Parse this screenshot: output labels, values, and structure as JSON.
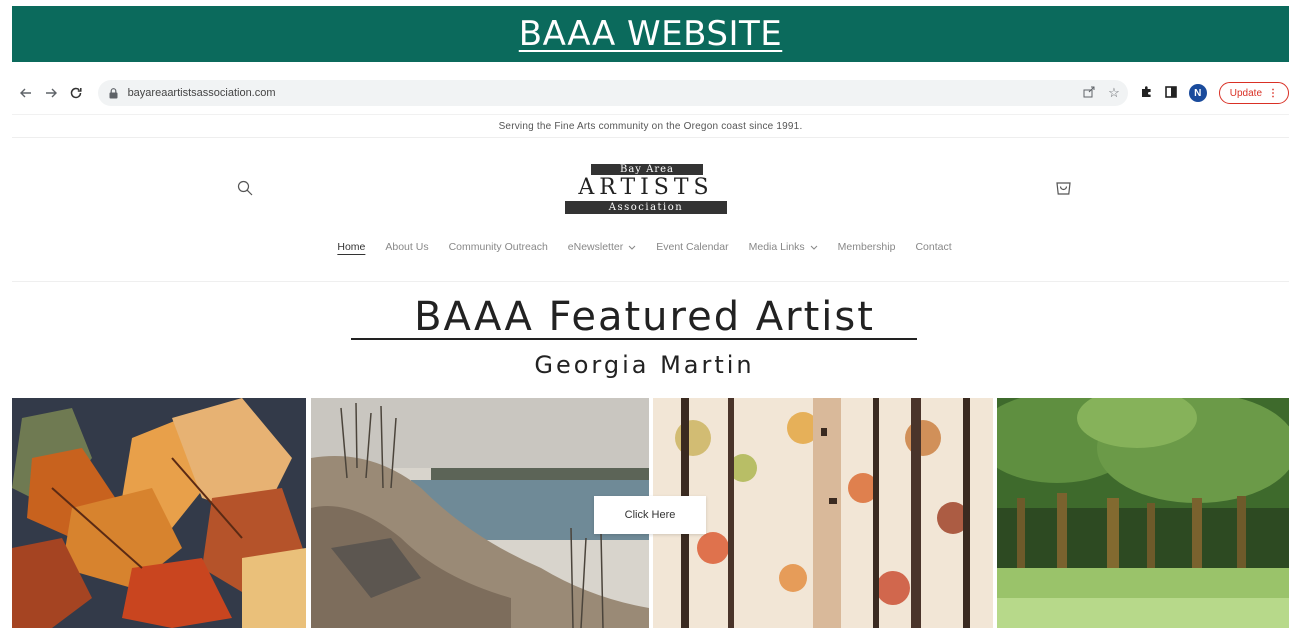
{
  "banner": {
    "title": "BAAA WEBSITE"
  },
  "browser": {
    "url": "bayareaartistsassociation.com",
    "avatar_letter": "N",
    "update_label": "Update",
    "icons": [
      "back-arrow-icon",
      "forward-arrow-icon",
      "reload-icon",
      "lock-icon",
      "share-icon",
      "star-icon",
      "puzzle-icon",
      "side-panel-icon",
      "more-vert-icon"
    ]
  },
  "site": {
    "announcement": "Serving the Fine Arts community on the Oregon coast since 1991.",
    "logo": {
      "top": "Bay Area",
      "middle": "ARTISTS",
      "bottom": "Association"
    },
    "nav": [
      {
        "label": "Home",
        "active": true,
        "dropdown": false
      },
      {
        "label": "About Us",
        "active": false,
        "dropdown": false
      },
      {
        "label": "Community Outreach",
        "active": false,
        "dropdown": false
      },
      {
        "label": "eNewsletter",
        "active": false,
        "dropdown": true
      },
      {
        "label": "Event Calendar",
        "active": false,
        "dropdown": false
      },
      {
        "label": "Media Links",
        "active": false,
        "dropdown": true
      },
      {
        "label": "Membership",
        "active": false,
        "dropdown": false
      },
      {
        "label": "Contact",
        "active": false,
        "dropdown": false
      }
    ]
  },
  "feature": {
    "title": "BAAA Featured Artist",
    "artist": "Georgia Martin",
    "cta_label": "Click Here",
    "paintings": [
      "autumn-leaves-painting",
      "coastal-dune-painting",
      "birch-trees-painting",
      "green-forest-painting"
    ]
  },
  "colors": {
    "banner": "#0b6a5c",
    "update": "#d93025",
    "avatar": "#1a4b9c"
  }
}
